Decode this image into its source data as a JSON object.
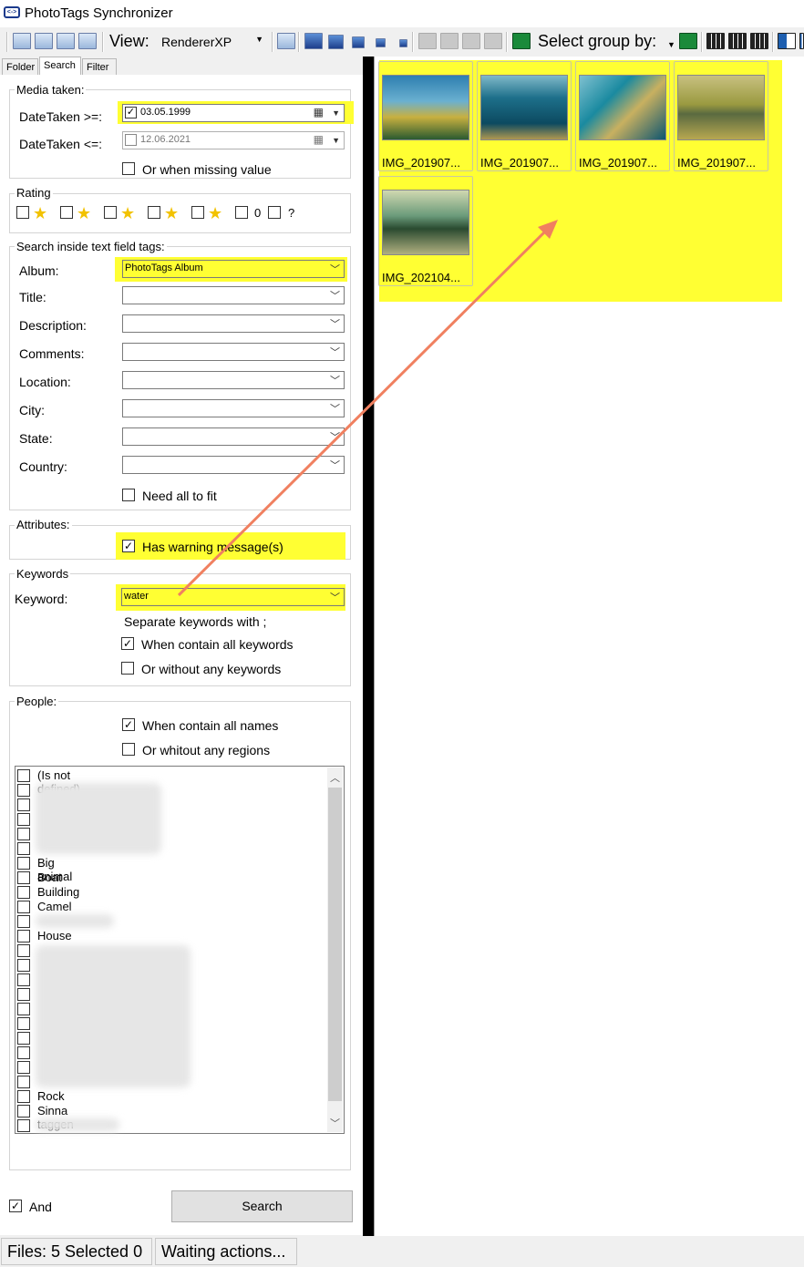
{
  "app": {
    "title": "PhotoTags Synchronizer",
    "icon": "app-icon"
  },
  "toolbar": {
    "view_label": "View:",
    "view_value": "RendererXP",
    "select_group_label": "Select group by:",
    "icons": [
      "layout-icon",
      "image-view-icon",
      "list-view-icon",
      "details-view-icon",
      "grid-icon",
      "large-thumb-icon",
      "medium-thumb-icon",
      "small-thumb-icon",
      "tiny-thumb-icon",
      "micro-thumb-icon",
      "rotate-left-icon",
      "rotate-icon",
      "rotate-right-icon",
      "print-icon",
      "refresh-group-icon",
      "refresh-icon",
      "columns-icon",
      "column-grid-icon",
      "column-dense-icon",
      "split-view-icon"
    ]
  },
  "tabs": [
    {
      "label": "Folder",
      "active": false
    },
    {
      "label": "Search",
      "active": true
    },
    {
      "label": "Filter",
      "active": false
    }
  ],
  "search": {
    "media_taken": {
      "legend": "Media taken:",
      "from_label": "DateTaken >=:",
      "from_value": "03.05.1999",
      "from_checked": true,
      "to_label": "DateTaken <=:",
      "to_value": "12.06.2021",
      "to_checked": false,
      "missing_label": "Or when missing value"
    },
    "rating": {
      "legend": "Rating",
      "zero_label": "0",
      "unknown_label": "?"
    },
    "text_tags": {
      "legend": "Search inside text field tags:",
      "fields": [
        {
          "label": "Album:",
          "value": "PhotoTags Album"
        },
        {
          "label": "Title:",
          "value": ""
        },
        {
          "label": "Description:",
          "value": ""
        },
        {
          "label": "Comments:",
          "value": ""
        },
        {
          "label": "Location:",
          "value": ""
        },
        {
          "label": "City:",
          "value": ""
        },
        {
          "label": "State:",
          "value": ""
        },
        {
          "label": "Country:",
          "value": ""
        }
      ],
      "need_all_label": "Need all to fit"
    },
    "attributes": {
      "legend": "Attributes:",
      "warning_label": "Has warning message(s)"
    },
    "keywords": {
      "legend": "Keywords",
      "keyword_label": "Keyword:",
      "keyword_value": "water",
      "hint": "Separate keywords with ;",
      "contain_all_label": "When contain all keywords",
      "without_any_label": "Or without any keywords"
    },
    "people": {
      "legend": "People:",
      "contain_all_label": "When contain all names",
      "without_regions_label": "Or whitout any regions",
      "names": [
        "(Is not defined)",
        "Big animal",
        "Boat",
        "Building",
        "Camel",
        "House",
        "Rock",
        "Sinna taggen"
      ]
    },
    "and_label": "And",
    "search_button": "Search"
  },
  "thumbnails": [
    {
      "name": "IMG_201907...",
      "colors": [
        "#2e7fb0",
        "#c8b040",
        "#2a5a30"
      ]
    },
    {
      "name": "IMG_201907...",
      "colors": [
        "#1d6f8a",
        "#0c4a60",
        "#b09850"
      ]
    },
    {
      "name": "IMG_201907...",
      "colors": [
        "#1a8aa0",
        "#c8b060",
        "#0d5570"
      ]
    },
    {
      "name": "IMG_201907...",
      "colors": [
        "#9a9a40",
        "#5a6a40",
        "#b8a850"
      ]
    },
    {
      "name": "IMG_202104...",
      "colors": [
        "#6a9a7a",
        "#2a4a30",
        "#b0b080"
      ]
    }
  ],
  "status": {
    "files": "Files: 5 Selected 0",
    "actions": "Waiting actions..."
  }
}
